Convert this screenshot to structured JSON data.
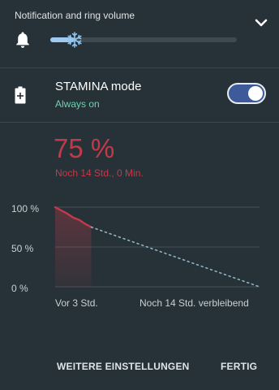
{
  "volume": {
    "title": "Notification and ring volume",
    "level_fraction": 0.13
  },
  "stamina": {
    "title": "STAMINA mode",
    "subtitle": "Always on",
    "enabled": true
  },
  "battery": {
    "percent_label": "75 %",
    "remaining_label": "Noch 14 Std.,  0 Min."
  },
  "chart_data": {
    "type": "line",
    "ytick_labels": [
      "100 %",
      "50 %",
      "0 %"
    ],
    "xtick_labels": [
      "Vor 3 Std.",
      "Noch 14 Std. verbleibend"
    ],
    "ylim": [
      0,
      100
    ],
    "grid": true,
    "series": [
      {
        "style": "history",
        "x": [
          -3,
          -2.5,
          -2,
          -1.5,
          -1,
          -0.5,
          0
        ],
        "y": [
          100,
          96,
          92,
          87,
          84,
          79,
          75
        ]
      },
      {
        "style": "projection",
        "x": [
          0,
          14
        ],
        "y": [
          75,
          0
        ]
      }
    ],
    "colors": {
      "history": "#c23a4a",
      "projection": "#8fb3c4"
    }
  },
  "footer": {
    "more_settings_label": "WEITERE EINSTELLUNGEN",
    "done_label": "FERTIG"
  },
  "icons": {
    "bell": "bell-icon",
    "expand": "chevron-down-icon",
    "battery": "battery-plus-icon",
    "slider_thumb": "snowflake-icon"
  }
}
